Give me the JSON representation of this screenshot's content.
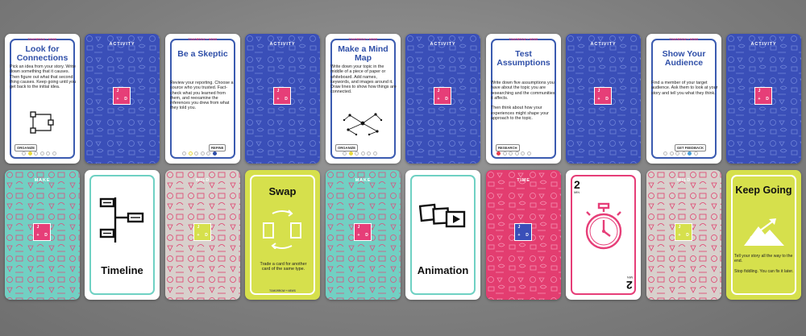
{
  "brand": "TOMORROW + NEWS",
  "colors": {
    "blue": "#3b5bb0",
    "navy": "#3a4fb8",
    "pink": "#e63e78",
    "teal": "#6fd1c3",
    "yellow": "#d6e04c",
    "grey": "#d8d0cc",
    "title": "#2f4fa8"
  },
  "logo": {
    "tl": "J",
    "tr": "",
    "bl": "+",
    "br": "D"
  },
  "activities": [
    {
      "title": "Look for Connections",
      "desc": "Pick an idea from your story. Write down something that it causes. Then figure out what that second thing causes. Keep going until you get back to the initial idea.",
      "category": "ORGANIZE",
      "icon": "flow-cycle-icon"
    },
    {
      "title": "Be a Skeptic",
      "desc": "Review your reporting. Choose a source who you trusted. Fact-check what you learned from them, and reexamine the inferences you drew from what they told you.",
      "category": "REFINE",
      "icon": "none"
    },
    {
      "title": "Make a Mind Map",
      "desc": "Write down your topic in the middle of a piece of paper or whiteboard. Add names, keywords, and images around it. Draw lines to show how things are connected.",
      "category": "ORGANIZE",
      "icon": "network-icon"
    },
    {
      "title": "Test Assumptions",
      "desc": "Write down five assumptions you have about the topic you are researching and the communities it affects.\n\nThen think about how your experiences might shape your approach to the topic.",
      "category": "RESEARCH",
      "icon": "none"
    },
    {
      "title": "Show Your Audience",
      "desc": "Find a member of your target audience. Ask them to look at your story and tell you what they think.",
      "category": "GET FEEDBACK",
      "icon": "none"
    }
  ],
  "activity_back_label": "ACTIVITY",
  "make_label": "MAKE",
  "wild_label": "WILD",
  "time_label": "TIME",
  "timeline": {
    "title": "Timeline"
  },
  "animation": {
    "title": "Animation"
  },
  "swap": {
    "title": "Swap",
    "desc": "Trade a card for another card of the same type."
  },
  "time_card": {
    "number": "2",
    "unit": "MIN"
  },
  "keep_going": {
    "title": "Keep Going",
    "desc1": "Tell your story all the way to the end.",
    "desc2": "Stop fiddling. You can fix it later."
  }
}
